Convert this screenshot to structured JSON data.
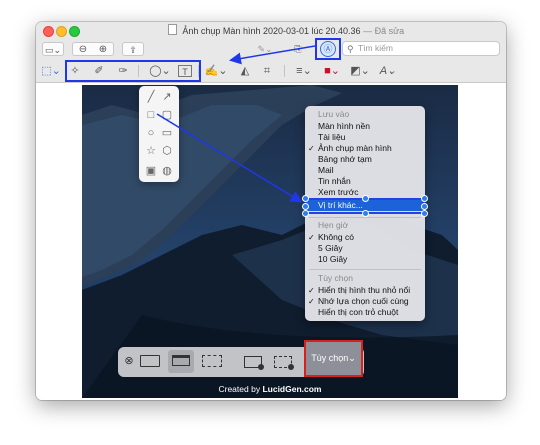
{
  "window": {
    "title": "Ảnh chụp Màn hình 2020-03-01 lúc 20.40.36",
    "edited": "— Đã sửa"
  },
  "toolbar": {
    "search_placeholder": "Tìm kiếm",
    "sidebar_toggle": "▭⌄",
    "zoom_out": "⊖",
    "zoom_in": "⊕",
    "share": "⇪",
    "markup": "Ⓐ",
    "pen": "✎⌄",
    "rotate": "⎘"
  },
  "markup_toolbar": {
    "select": "⬚⌄",
    "instant_alpha": "✧",
    "sketch": "✐",
    "draw": "✑",
    "shapes": "◯⌄",
    "text": "T",
    "sign": "✍⌄",
    "adjust_color": "◭",
    "crop": "⌗",
    "line_style": "≡⌄",
    "border_color": "■⌄",
    "fill_color": "◩⌄",
    "text_style": "A⌄"
  },
  "shapes_popover": [
    "╱",
    "↗",
    "□",
    "▢",
    "○",
    "▭",
    "☆",
    "⬡",
    "▣",
    "◍"
  ],
  "options_menu": {
    "save_heading": "Lưu vào",
    "save_items": [
      {
        "label": "Màn hình nền",
        "checked": false
      },
      {
        "label": "Tài liệu",
        "checked": false
      },
      {
        "label": "Ảnh chụp màn hình",
        "checked": true
      },
      {
        "label": "Bảng nhớ tạm",
        "checked": false
      },
      {
        "label": "Mail",
        "checked": false
      },
      {
        "label": "Tin nhắn",
        "checked": false
      },
      {
        "label": "Xem trước",
        "checked": false
      },
      {
        "label": "Vị trí khác...",
        "checked": false,
        "selected": true
      }
    ],
    "timer_heading": "Hẹn giờ",
    "timer_items": [
      {
        "label": "Không có",
        "checked": true
      },
      {
        "label": "5 Giây",
        "checked": false
      },
      {
        "label": "10 Giây",
        "checked": false
      }
    ],
    "options_heading": "Tùy chọn",
    "option_items": [
      {
        "label": "Hiển thị hình thu nhỏ nổi",
        "checked": true
      },
      {
        "label": "Nhớ lựa chọn cuối cùng",
        "checked": true
      },
      {
        "label": "Hiển thị con trỏ chuột",
        "checked": false
      }
    ],
    "check_mark": "✓"
  },
  "capture_bar": {
    "close": "⊗",
    "options_label": "Tùy chọn⌄"
  },
  "credit": {
    "prefix": "Created by",
    "brand": "LucidGen.com"
  },
  "colors": {
    "highlight": "#1f37e8",
    "menu_selection": "#1c62d9",
    "options_border": "#d8201c"
  }
}
